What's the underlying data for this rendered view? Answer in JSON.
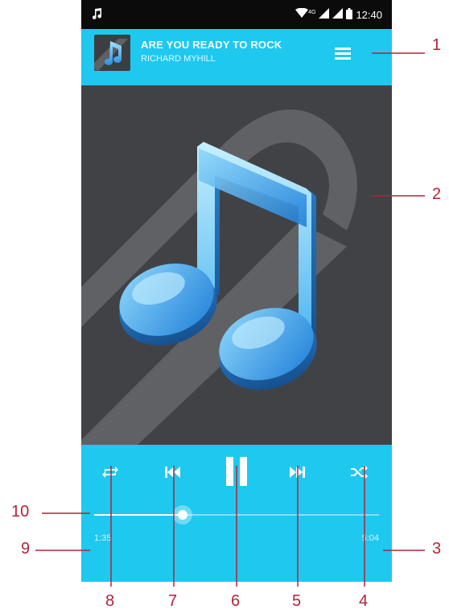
{
  "status_bar": {
    "time": "12:40",
    "network_label": "4G",
    "left_icon": "music-note-icon"
  },
  "now_playing": {
    "title": "ARE YOU READY TO ROCK",
    "artist": "RICHARD MYHILL",
    "menu_icon": "hamburger-menu-icon"
  },
  "player": {
    "elapsed": "1:35",
    "duration": "5:04",
    "progress": 0.31,
    "controls": [
      "repeat",
      "previous",
      "pause",
      "next",
      "shuffle"
    ]
  },
  "callouts": {
    "c1": "1",
    "c2": "2",
    "c3": "3",
    "c4": "4",
    "c5": "5",
    "c6": "6",
    "c7": "7",
    "c8": "8",
    "c9": "9",
    "c10": "10"
  },
  "colors": {
    "accent": "#1ec8ef",
    "artwork_bg": "#414246",
    "annotation": "#b4233a"
  }
}
